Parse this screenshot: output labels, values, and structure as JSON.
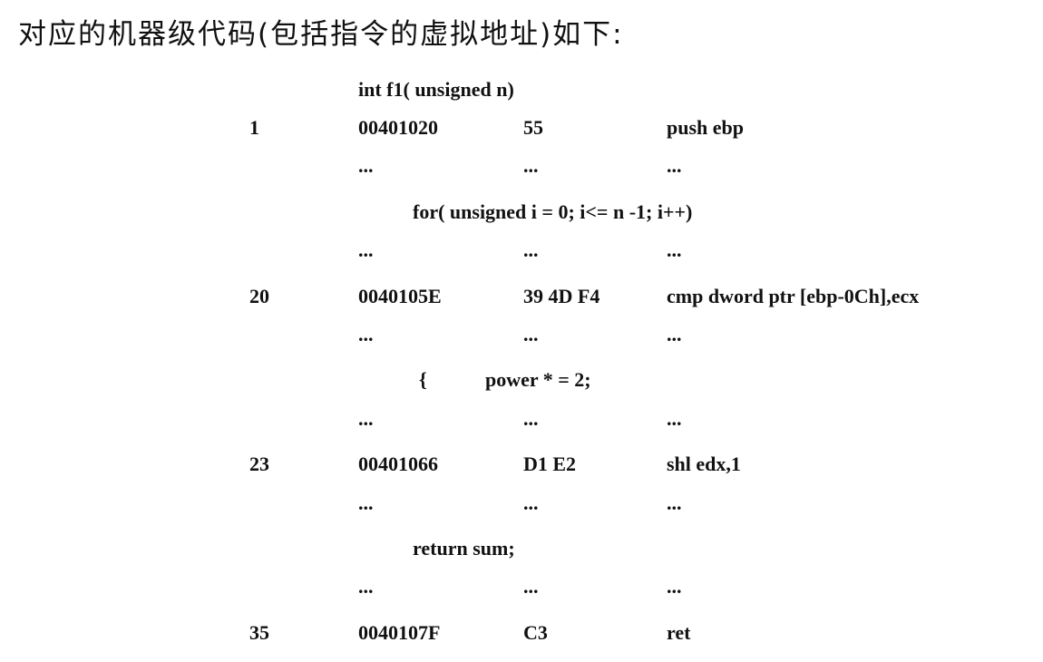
{
  "heading": "对应的机器级代码(包括指令的虚拟地址)如下:",
  "signature": "int f1( unsigned n)",
  "rows": [
    {
      "kind": "instr",
      "num": "1",
      "addr": "00401020",
      "bytes": "55",
      "asm": "push ebp"
    },
    {
      "kind": "dots",
      "addr": "...",
      "bytes": "...",
      "asm": "..."
    },
    {
      "kind": "src",
      "text": "for( unsigned i = 0; i<= n -1; i++)"
    },
    {
      "kind": "dots",
      "addr": "...",
      "bytes": "...",
      "asm": "..."
    },
    {
      "kind": "instr",
      "num": "20",
      "addr": "0040105E",
      "bytes": "39 4D F4",
      "asm": "cmp dword ptr [ebp-0Ch],ecx"
    },
    {
      "kind": "dots",
      "addr": "...",
      "bytes": "...",
      "asm": "..."
    },
    {
      "kind": "src2",
      "brace": "{",
      "text": "power * = 2;"
    },
    {
      "kind": "dots",
      "addr": "...",
      "bytes": "...",
      "asm": "..."
    },
    {
      "kind": "instr",
      "num": "23",
      "addr": "00401066",
      "bytes": "D1 E2",
      "asm": "shl   edx,1"
    },
    {
      "kind": "dots",
      "addr": "...",
      "bytes": "...",
      "asm": "..."
    },
    {
      "kind": "src",
      "text": "return sum;"
    },
    {
      "kind": "dots",
      "addr": "...",
      "bytes": "...",
      "asm": "..."
    },
    {
      "kind": "instr",
      "num": "35",
      "addr": "0040107F",
      "bytes": "C3",
      "asm": "ret"
    }
  ]
}
